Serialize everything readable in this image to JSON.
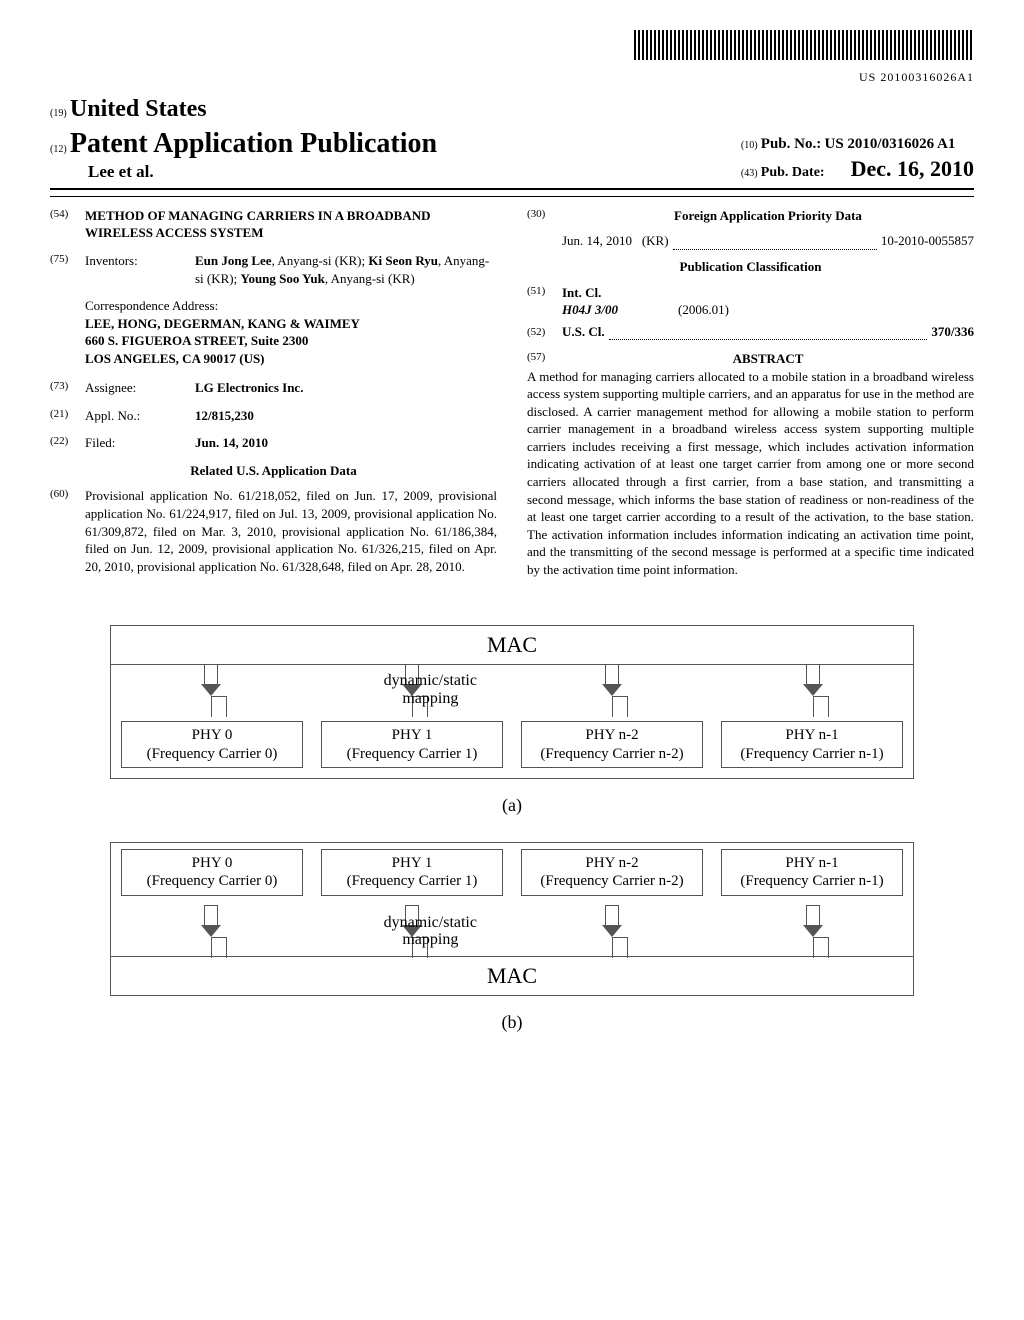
{
  "barcode_number": "US 20100316026A1",
  "header": {
    "country_prefix": "(19)",
    "country": "United States",
    "pub_prefix": "(12)",
    "pub_type": "Patent Application Publication",
    "authors": "Lee et al.",
    "pub_no_prefix": "(10)",
    "pub_no_label": "Pub. No.:",
    "pub_no": "US 2010/0316026 A1",
    "pub_date_prefix": "(43)",
    "pub_date_label": "Pub. Date:",
    "pub_date": "Dec. 16, 2010"
  },
  "title": {
    "num": "(54)",
    "text": "METHOD OF MANAGING CARRIERS IN A BROADBAND WIRELESS ACCESS SYSTEM"
  },
  "inventors": {
    "num": "(75)",
    "label": "Inventors:",
    "text": "Eun Jong Lee, Anyang-si (KR); Ki Seon Ryu, Anyang-si (KR); Young Soo Yuk, Anyang-si (KR)"
  },
  "correspondence": {
    "label": "Correspondence Address:",
    "lines": [
      "LEE, HONG, DEGERMAN, KANG & WAIMEY",
      "660 S. FIGUEROA STREET, Suite 2300",
      "LOS ANGELES, CA 90017 (US)"
    ]
  },
  "assignee": {
    "num": "(73)",
    "label": "Assignee:",
    "val": "LG Electronics Inc."
  },
  "appl_no": {
    "num": "(21)",
    "label": "Appl. No.:",
    "val": "12/815,230"
  },
  "filed": {
    "num": "(22)",
    "label": "Filed:",
    "val": "Jun. 14, 2010"
  },
  "related": {
    "heading": "Related U.S. Application Data",
    "num": "(60)",
    "text": "Provisional application No. 61/218,052, filed on Jun. 17, 2009, provisional application No. 61/224,917, filed on Jul. 13, 2009, provisional application No. 61/309,872, filed on Mar. 3, 2010, provisional application No. 61/186,384, filed on Jun. 12, 2009, provisional application No. 61/326,215, filed on Apr. 20, 2010, provisional application No. 61/328,648, filed on Apr. 28, 2010."
  },
  "foreign": {
    "num": "(30)",
    "heading": "Foreign Application Priority Data",
    "date": "Jun. 14, 2010",
    "country": "(KR)",
    "appnum": "10-2010-0055857"
  },
  "classification": {
    "heading": "Publication Classification",
    "intcl": {
      "num": "(51)",
      "label": "Int. Cl.",
      "code": "H04J 3/00",
      "edition": "(2006.01)"
    },
    "uscl": {
      "num": "(52)",
      "label": "U.S. Cl.",
      "val": "370/336"
    }
  },
  "abstract": {
    "num": "(57)",
    "heading": "ABSTRACT",
    "text": "A method for managing carriers allocated to a mobile station in a broadband wireless access system supporting multiple carriers, and an apparatus for use in the method are disclosed. A carrier management method for allowing a mobile station to perform carrier management in a broadband wireless access system supporting multiple carriers includes receiving a first message, which includes activation information indicating activation of at least one target carrier from among one or more second carriers allocated through a first carrier, from a base station, and transmitting a second message, which informs the base station of readiness or non-readiness of the at least one target carrier according to a result of the activation, to the base station. The activation information includes information indicating an activation time point, and the transmitting of the second message is performed at a specific time indicated by the activation time point information."
  },
  "figures": {
    "mac_label": "MAC",
    "mapping_label": "dynamic/static\nmapping",
    "phy": [
      {
        "name": "PHY 0",
        "carrier": "(Frequency Carrier 0)"
      },
      {
        "name": "PHY 1",
        "carrier": "(Frequency Carrier 1)"
      },
      {
        "name": "PHY n-2",
        "carrier": "(Frequency Carrier n-2)"
      },
      {
        "name": "PHY n-1",
        "carrier": "(Frequency Carrier n-1)"
      }
    ],
    "sub_a": "(a)",
    "sub_b": "(b)"
  }
}
